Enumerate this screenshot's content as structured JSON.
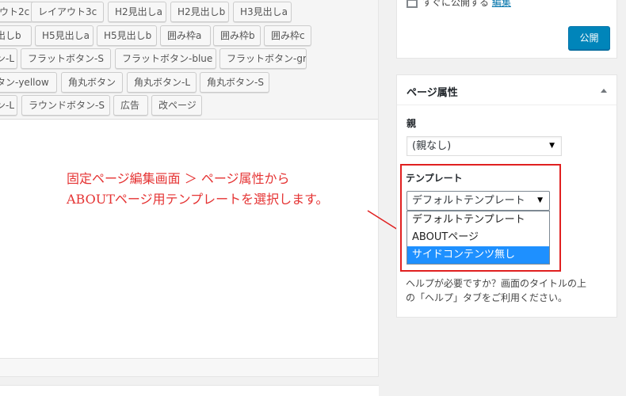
{
  "toolbar": {
    "rows": [
      [
        "ウト2c",
        "レイアウト3c",
        "H2見出しa",
        "H2見出しb",
        "H3見出しa"
      ],
      [
        "出しb",
        "H5見出しa",
        "H5見出しb",
        "囲み枠a",
        "囲み枠b",
        "囲み枠c"
      ],
      [
        "ン-L",
        "フラットボタン-S",
        "フラットボタン-blue",
        "フラットボタン-green"
      ],
      [
        "タン-yellow",
        "角丸ボタン",
        "角丸ボタン-L",
        "角丸ボタン-S"
      ],
      [
        "ン-L",
        "ラウンドボタン-S",
        "広告",
        "改ページ"
      ]
    ]
  },
  "annotation": {
    "line1": "固定ページ編集画面 ＞ ページ属性から",
    "line2": "ABOUTページ用テンプレートを選択します。",
    "color": "#e53333"
  },
  "publish": {
    "status_text": "すぐに公開する",
    "edit_link": "編集",
    "button_label": "公開",
    "accent": "#0085ba"
  },
  "page_attributes": {
    "title": "ページ属性",
    "parent_label": "親",
    "parent_value": "(親なし)",
    "template_label": "テンプレート",
    "template_value": "デフォルトテンプレート",
    "template_options": [
      "デフォルトテンプレート",
      "ABOUTページ",
      "サイドコンテンツ無し"
    ],
    "highlighted_option": "サイドコンテンツ無し",
    "help_line1": "ヘルプが必要ですか？画面のタイトルの上",
    "help_line2": "の「ヘルプ」タブをご利用ください。"
  }
}
